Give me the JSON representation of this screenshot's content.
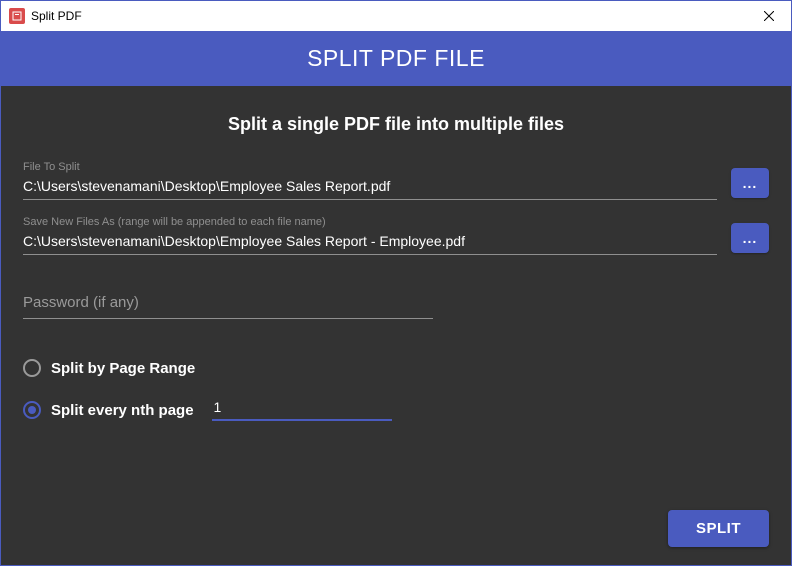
{
  "window": {
    "title": "Split PDF"
  },
  "header": {
    "title": "SPLIT PDF FILE"
  },
  "subtitle": "Split a single PDF file into multiple files",
  "fields": {
    "file_to_split": {
      "label": "File To Split",
      "value": "C:\\Users\\stevenamani\\Desktop\\Employee Sales Report.pdf"
    },
    "save_as": {
      "label": "Save New Files As (range will be appended to each file name)",
      "value": "C:\\Users\\stevenamani\\Desktop\\Employee Sales Report - Employee.pdf"
    },
    "password": {
      "placeholder": "Password (if any)",
      "value": ""
    }
  },
  "browse_label": "...",
  "options": {
    "by_range": {
      "label": "Split by Page Range",
      "selected": false
    },
    "every_nth": {
      "label": "Split every nth page",
      "selected": true,
      "value": "1"
    }
  },
  "buttons": {
    "split": "SPLIT"
  }
}
